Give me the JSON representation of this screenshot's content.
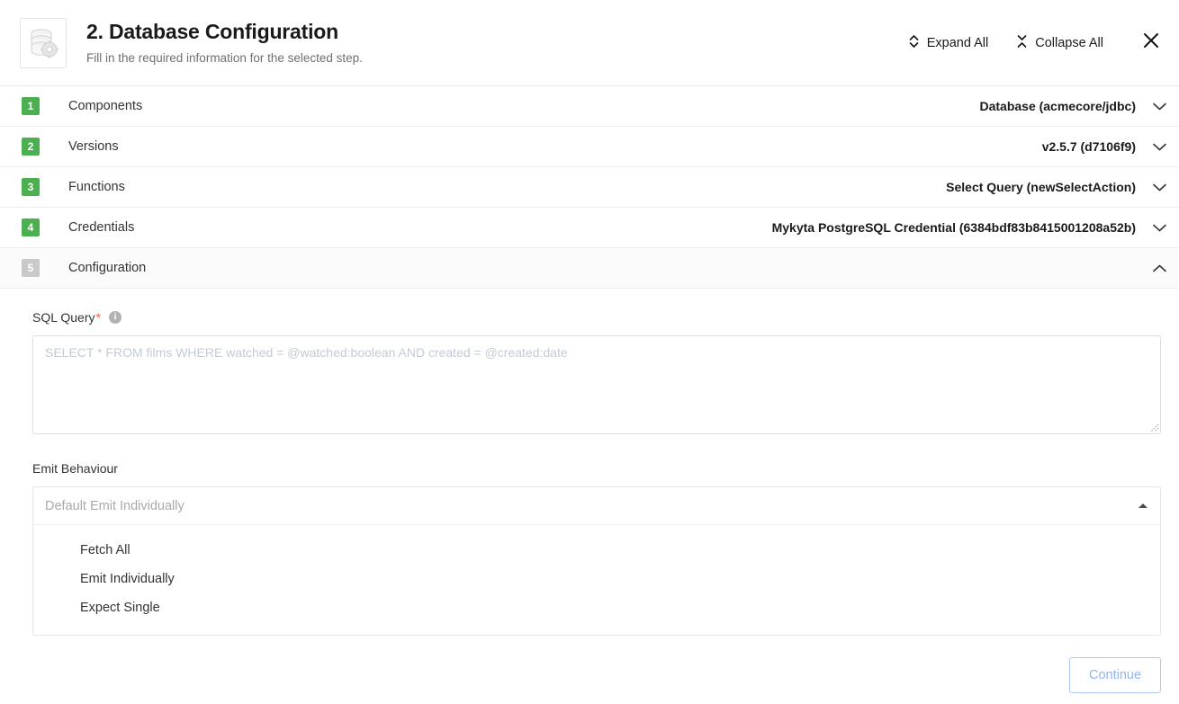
{
  "header": {
    "icon": "database-gear-icon",
    "title": "2. Database Configuration",
    "subtitle": "Fill in the required information for the selected step.",
    "expand_all_label": "Expand All",
    "collapse_all_label": "Collapse All",
    "expand_icon": "expand-vertical-icon",
    "collapse_icon": "collapse-vertical-icon",
    "close_icon": "close-icon"
  },
  "accordion": {
    "rows": [
      {
        "number": "1",
        "label": "Components",
        "value": "Database (acmecore/jdbc)",
        "state": "collapsed",
        "badge": "active"
      },
      {
        "number": "2",
        "label": "Versions",
        "value": "v2.5.7 (d7106f9)",
        "state": "collapsed",
        "badge": "active"
      },
      {
        "number": "3",
        "label": "Functions",
        "value": "Select Query (newSelectAction)",
        "state": "collapsed",
        "badge": "active"
      },
      {
        "number": "4",
        "label": "Credentials",
        "value": "Mykyta PostgreSQL Credential (6384bdf83b8415001208a52b)",
        "state": "collapsed",
        "badge": "active"
      },
      {
        "number": "5",
        "label": "Configuration",
        "value": "",
        "state": "expanded",
        "badge": "inactive"
      }
    ]
  },
  "configuration": {
    "sql_query": {
      "label": "SQL Query",
      "required_marker": "*",
      "info_icon": "info-icon",
      "info_glyph": "i",
      "value": "",
      "placeholder": "SELECT * FROM films WHERE watched = @watched:boolean AND created = @created:date"
    },
    "emit_behaviour": {
      "label": "Emit Behaviour",
      "selected_value": "",
      "placeholder": "Default Emit Individually",
      "caret_icon": "caret-up-icon",
      "open": true,
      "options": [
        "Fetch All",
        "Emit Individually",
        "Expect Single"
      ]
    }
  },
  "footer": {
    "continue_label": "Continue",
    "continue_enabled": false
  },
  "colors": {
    "badge_active": "#4caf50",
    "badge_inactive": "#c9c9c9",
    "required": "#e8604c",
    "button_border": "#a9c6f5",
    "button_text": "#93b4ee"
  }
}
